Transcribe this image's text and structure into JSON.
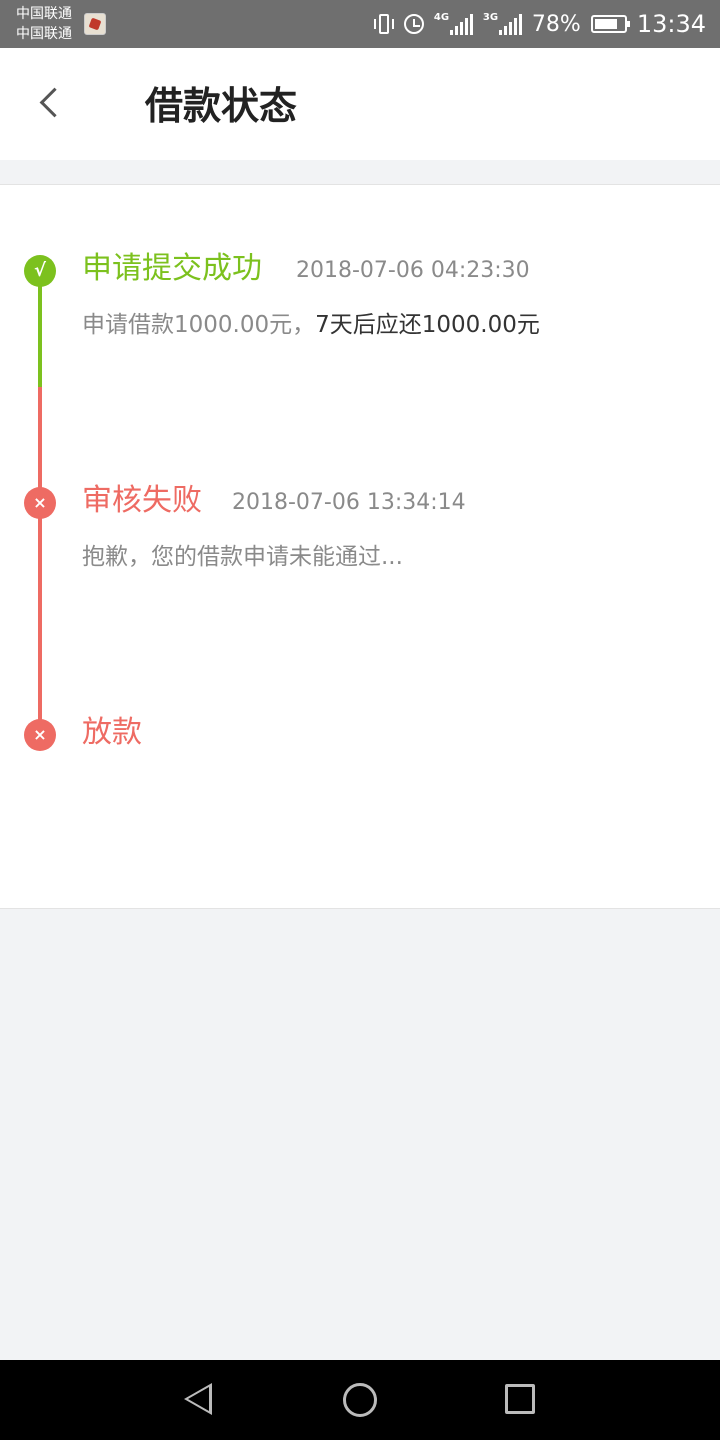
{
  "status_bar": {
    "carrier_1": "中国联通",
    "carrier_2": "中国联通",
    "network_1": "4G",
    "network_2": "3G",
    "battery": "78%",
    "time": "13:34"
  },
  "header": {
    "title": "借款状态"
  },
  "timeline": [
    {
      "title": "申请提交成功",
      "time": "2018-07-06 04:23:30",
      "status": "success",
      "icon": "check-icon",
      "icon_glyph": "√",
      "desc": "申请借款1000.00元，",
      "desc_strong": "7天后应还1000.00元"
    },
    {
      "title": "审核失败",
      "time": "2018-07-06 13:34:14",
      "status": "failed",
      "icon": "cross-icon",
      "icon_glyph": "×",
      "desc": "抱歉，您的借款申请未能通过..."
    },
    {
      "title": "放款",
      "status": "failed",
      "icon": "cross-icon",
      "icon_glyph": "×"
    }
  ],
  "colors": {
    "success": "#7cc11e",
    "failed": "#ee6b63",
    "background": "#f2f3f5"
  }
}
